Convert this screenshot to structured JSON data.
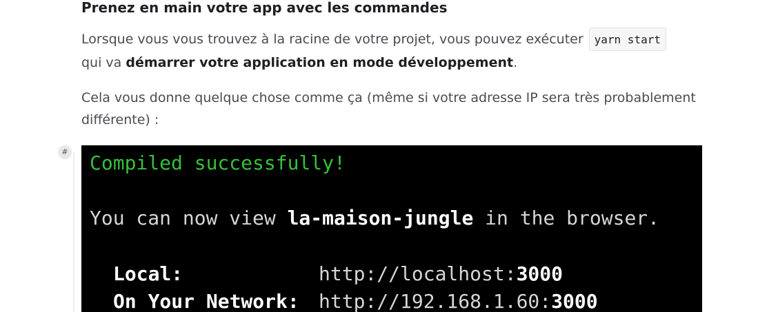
{
  "section": {
    "heading": "Prenez en main votre app avec les commandes"
  },
  "para1": {
    "text_before": "Lorsque vous vous trouvez à la racine de votre projet, vous pouvez exécuter",
    "code": "yarn start",
    "text_mid": "qui va ",
    "bold": "démarrer votre application en mode développement",
    "text_after": "."
  },
  "para2": {
    "text": "Cela vous donne quelque chose comme ça (même si votre adresse IP sera très probablement différente) :"
  },
  "anchor": {
    "symbol": "#"
  },
  "terminal": {
    "compiled": "Compiled successfully!",
    "view_prefix": "You can now view ",
    "app_name": "la-maison-jungle",
    "view_suffix": " in the browser.",
    "local_label": "Local:",
    "local_url_base": "http://localhost:",
    "local_port": "3000",
    "network_label": "On Your Network:",
    "network_url_base": "http://192.168.1.60:",
    "network_port": "3000",
    "colors": {
      "background": "#000000",
      "success": "#35c13a",
      "text": "#d6d6d6",
      "bold": "#ffffff"
    }
  }
}
